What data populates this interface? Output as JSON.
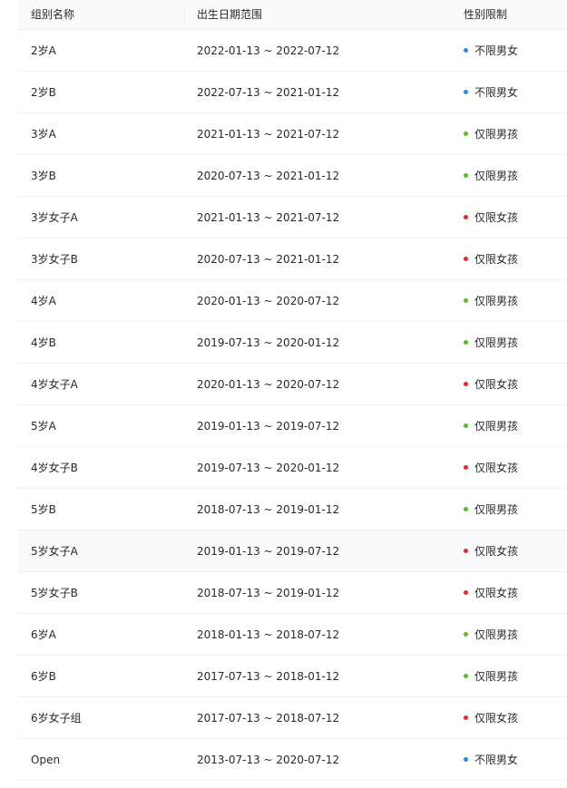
{
  "table": {
    "headers": [
      "组别名称",
      "出生日期范围",
      "性别限制"
    ],
    "status_colors": {
      "unlimited": "#1890ff",
      "boys": "#52c41a",
      "girls": "#f5222d"
    },
    "rows": [
      {
        "name": "2岁A",
        "range": "2022-01-13 ~ 2022-07-12",
        "gender": "不限男女",
        "type": "unlimited"
      },
      {
        "name": "2岁B",
        "range": "2022-07-13 ~ 2021-01-12",
        "gender": "不限男女",
        "type": "unlimited"
      },
      {
        "name": "3岁A",
        "range": "2021-01-13 ~ 2021-07-12",
        "gender": "仅限男孩",
        "type": "boys"
      },
      {
        "name": "3岁B",
        "range": "2020-07-13 ~ 2021-01-12",
        "gender": "仅限男孩",
        "type": "boys"
      },
      {
        "name": "3岁女子A",
        "range": "2021-01-13 ~ 2021-07-12",
        "gender": "仅限女孩",
        "type": "girls"
      },
      {
        "name": "3岁女子B",
        "range": "2020-07-13 ~ 2021-01-12",
        "gender": "仅限女孩",
        "type": "girls"
      },
      {
        "name": "4岁A",
        "range": "2020-01-13 ~ 2020-07-12",
        "gender": "仅限男孩",
        "type": "boys"
      },
      {
        "name": "4岁B",
        "range": "2019-07-13 ~ 2020-01-12",
        "gender": "仅限男孩",
        "type": "boys"
      },
      {
        "name": "4岁女子A",
        "range": "2020-01-13 ~ 2020-07-12",
        "gender": "仅限女孩",
        "type": "girls"
      },
      {
        "name": "5岁A",
        "range": "2019-01-13 ~ 2019-07-12",
        "gender": "仅限男孩",
        "type": "boys"
      },
      {
        "name": "4岁女子B",
        "range": "2019-07-13 ~ 2020-01-12",
        "gender": "仅限女孩",
        "type": "girls"
      },
      {
        "name": "5岁B",
        "range": "2018-07-13 ~ 2019-01-12",
        "gender": "仅限男孩",
        "type": "boys"
      },
      {
        "name": "5岁女子A",
        "range": "2019-01-13 ~ 2019-07-12",
        "gender": "仅限女孩",
        "type": "girls",
        "hover": true
      },
      {
        "name": "5岁女子B",
        "range": "2018-07-13 ~ 2019-01-12",
        "gender": "仅限女孩",
        "type": "girls"
      },
      {
        "name": "6岁A",
        "range": "2018-01-13 ~ 2018-07-12",
        "gender": "仅限男孩",
        "type": "boys"
      },
      {
        "name": "6岁B",
        "range": "2017-07-13 ~ 2018-01-12",
        "gender": "仅限男孩",
        "type": "boys"
      },
      {
        "name": "6岁女子组",
        "range": "2017-07-13 ~ 2018-07-12",
        "gender": "仅限女孩",
        "type": "girls"
      },
      {
        "name": "Open",
        "range": "2013-07-13 ~ 2020-07-12",
        "gender": "不限男女",
        "type": "unlimited"
      }
    ]
  }
}
